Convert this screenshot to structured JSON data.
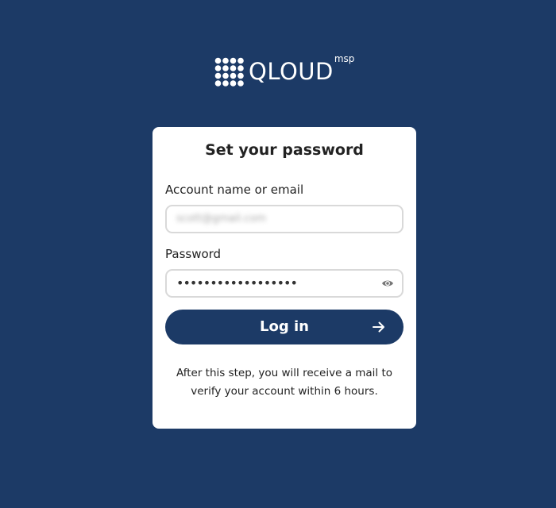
{
  "brand": {
    "name": "QLOUD",
    "suffix": "msp",
    "logo_icon": "qloud-dot-grid-icon",
    "bg_color": "#1c3a66"
  },
  "form": {
    "title": "Set your password",
    "account_label": "Account name or email",
    "account_value": "scott@gmail.com",
    "password_label": "Password",
    "password_value": "••••••••••••••••••",
    "toggle_icon": "eye-icon",
    "submit_label": "Log in",
    "submit_icon": "arrow-right-icon",
    "note": "After this step, you will receive a mail to verify your account within 6 hours."
  }
}
